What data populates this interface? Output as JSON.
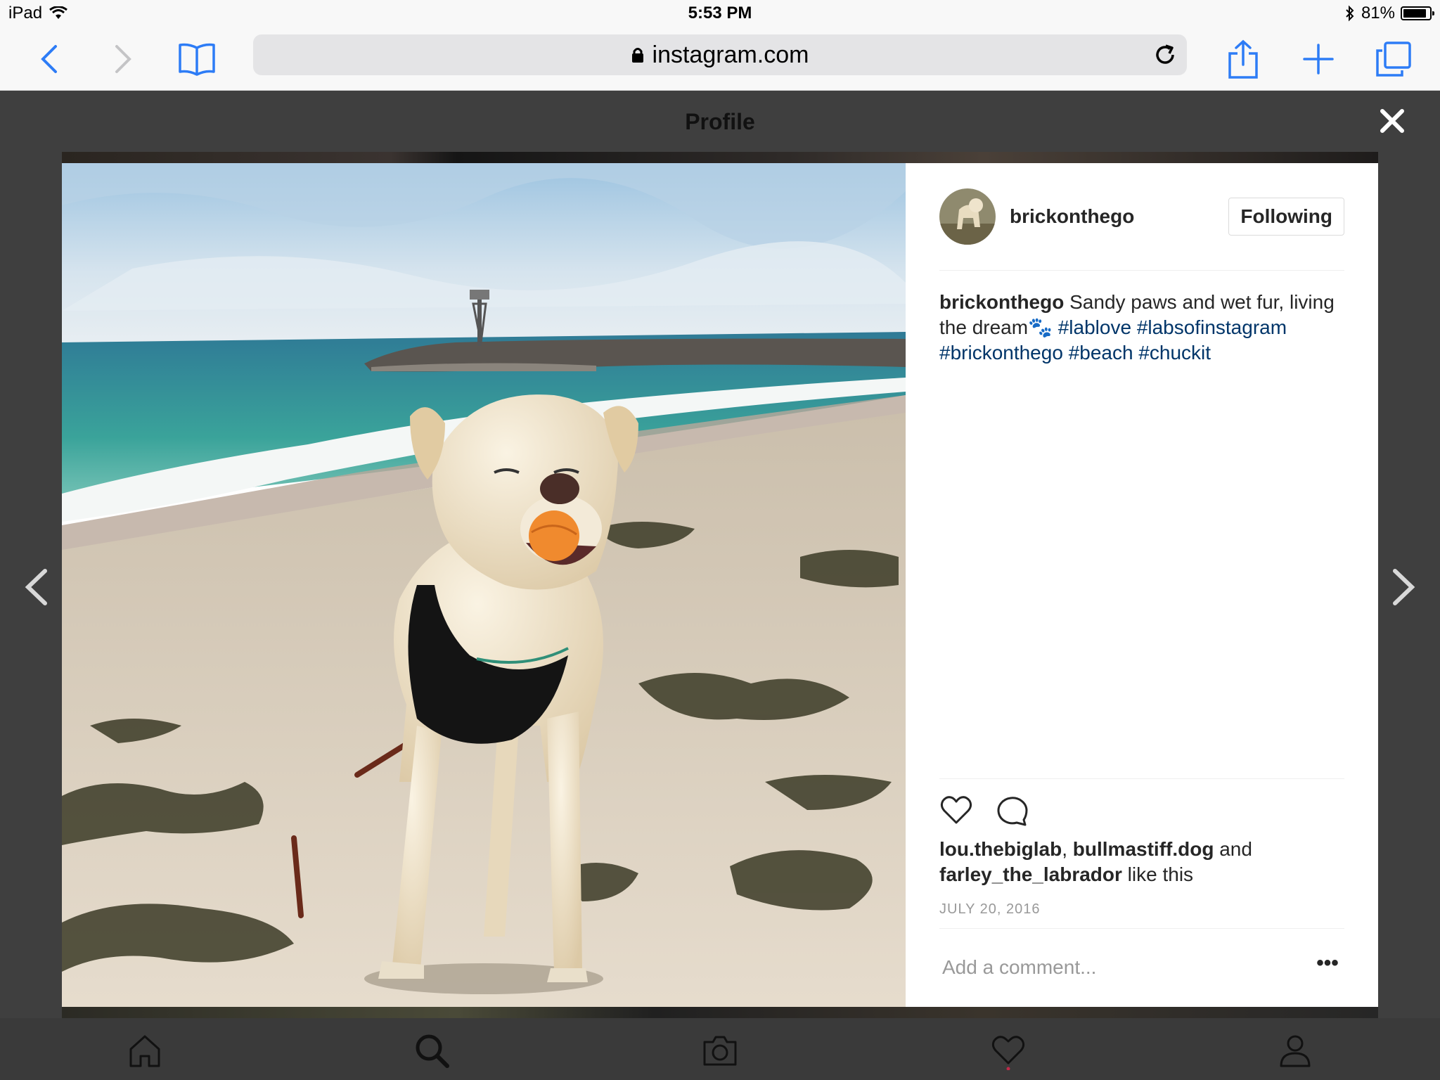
{
  "status_bar": {
    "device": "iPad",
    "time": "5:53 PM",
    "battery": "81%"
  },
  "browser": {
    "url": "instagram.com"
  },
  "overlay": {
    "title": "Profile"
  },
  "post": {
    "username": "brickonthego",
    "follow_label": "Following",
    "caption_text": "Sandy paws and wet fur, living the dream🐾",
    "hashtags": [
      "#lablove",
      "#labsofinstagram",
      "#brickonthego",
      "#beach",
      "#chuckit"
    ],
    "likes": {
      "users": [
        "lou.thebiglab",
        "bullmastiff.dog",
        "farley_the_labrador"
      ],
      "separator": ",",
      "and": "and",
      "suffix": "like this"
    },
    "date": "JULY 20, 2016",
    "comment_placeholder": "Add a comment...",
    "more": "•••"
  },
  "colors": {
    "hashtag": "#003569",
    "overlay": "#3f3f3f",
    "ios_blue": "#2d7cf6"
  }
}
